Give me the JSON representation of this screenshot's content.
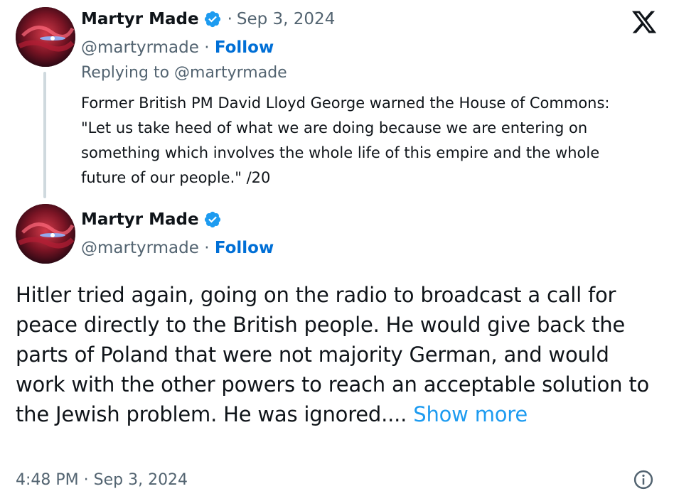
{
  "parent_tweet": {
    "author_name": "Martyr Made",
    "date": "Sep 3, 2024",
    "handle": "@martyrmade",
    "follow_label": "Follow",
    "replying_to_label": "Replying to @martyrmade",
    "text": "Former British PM David Lloyd George warned the House of Commons: \"Let us take heed of what we are doing because we are entering on something which involves the whole life of this empire and the whole future of our people.\" /20"
  },
  "main_tweet": {
    "author_name": "Martyr Made",
    "handle": "@martyrmade",
    "follow_label": "Follow",
    "text": "Hitler tried again, going on the radio to broadcast a call for peace directly to the British people. He would give back the parts of Poland that were not majority German, and would work with the other powers to reach an acceptable solution to the Jewish problem. He was ignored....",
    "show_more_label": "Show more",
    "timestamp": "4:48 PM · Sep 3, 2024"
  },
  "icons": {
    "brand": "x-logo-icon",
    "verified": "verified-badge-icon",
    "info": "info-icon"
  },
  "colors": {
    "follow": "#006fd6",
    "show_more": "#1d9bf0",
    "verified": "#1d9bf0",
    "secondary_text": "#536471"
  }
}
